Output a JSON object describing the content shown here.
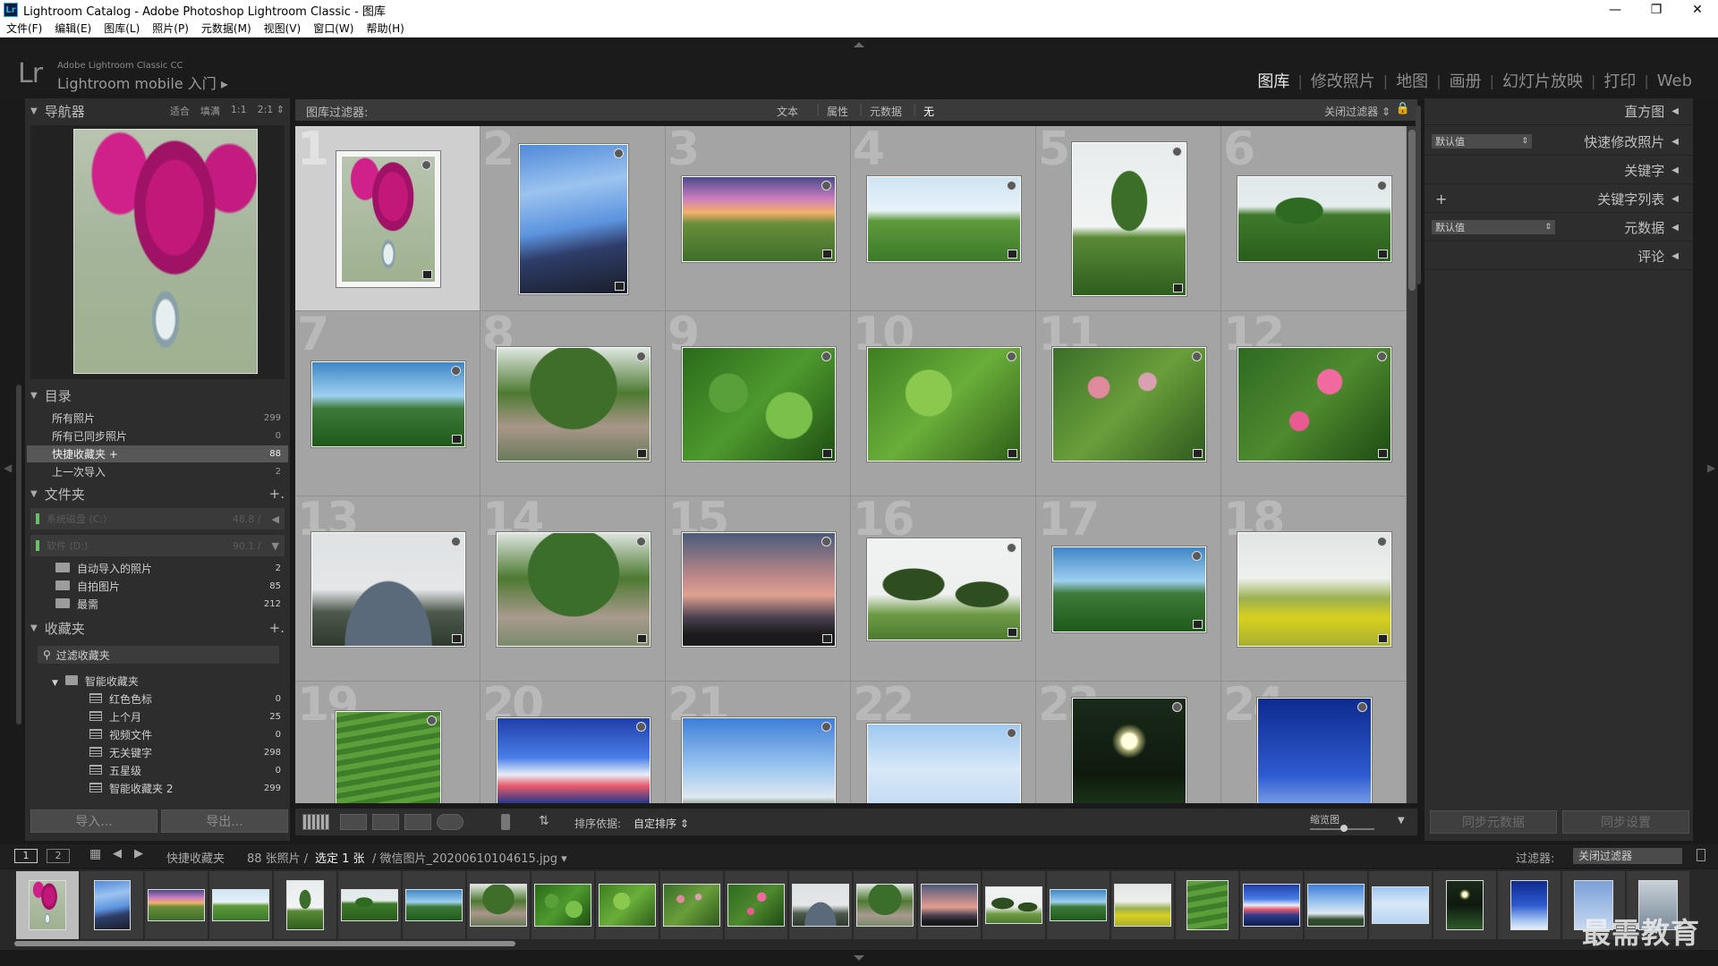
{
  "window": {
    "title": "Lightroom Catalog - Adobe Photoshop Lightroom Classic - 图库",
    "app_icon": "Lr",
    "controls": [
      "—",
      "❐",
      "✕"
    ]
  },
  "menu": [
    "文件(F)",
    "编辑(E)",
    "图库(L)",
    "照片(P)",
    "元数据(M)",
    "视图(V)",
    "窗口(W)",
    "帮助(H)"
  ],
  "identity": {
    "logo": "Lr",
    "small": "Adobe Lightroom Classic CC",
    "main": "Lightroom mobile 入门 ▸"
  },
  "modules": [
    "图库",
    "修改照片",
    "地图",
    "画册",
    "幻灯片放映",
    "打印",
    "Web"
  ],
  "navigator": {
    "title": "导航器",
    "zoom": [
      "适合",
      "填满",
      "1:1",
      "2:1 ⇕"
    ]
  },
  "catalog": {
    "title": "目录",
    "items": [
      {
        "label": "所有照片",
        "count": "299"
      },
      {
        "label": "所有已同步照片",
        "count": "0"
      },
      {
        "label": "快捷收藏夹 +",
        "count": "88"
      },
      {
        "label": "上一次导入",
        "count": "2"
      }
    ]
  },
  "folders": {
    "title": "文件夹",
    "add": "+.",
    "volumes": [
      {
        "label": "系统磁盘 (C:)",
        "size": "48.8 /",
        "arrow": "◀"
      },
      {
        "label": "软件 (D:)",
        "size": "90.1 /",
        "arrow": "▼"
      }
    ],
    "items": [
      {
        "label": "自动导入的照片",
        "count": "2"
      },
      {
        "label": "自拍图片",
        "count": "85"
      },
      {
        "label": "最需",
        "count": "212"
      }
    ]
  },
  "collections": {
    "title": "收藏夹",
    "add": "+.",
    "filter_label": "过滤收藏夹",
    "smart_group": "智能收藏夹",
    "items": [
      {
        "label": "红色色标",
        "count": "0"
      },
      {
        "label": "上个月",
        "count": "25"
      },
      {
        "label": "视频文件",
        "count": "0"
      },
      {
        "label": "无关键字",
        "count": "298"
      },
      {
        "label": "五星级",
        "count": "0"
      },
      {
        "label": "智能收藏夹 2",
        "count": "299"
      }
    ]
  },
  "left_buttons": {
    "import": "导入...",
    "export": "导出..."
  },
  "filter_bar": {
    "label": "图库过滤器:",
    "options": [
      "文本",
      "属性",
      "元数据",
      "无"
    ],
    "right": "关闭过滤器 ⇕"
  },
  "grid": {
    "numbers": [
      "1",
      "2",
      "3",
      "4",
      "5",
      "6",
      "7",
      "8",
      "9",
      "10",
      "11",
      "12",
      "13",
      "14",
      "15",
      "16",
      "17",
      "18",
      "19",
      "20",
      "21",
      "22",
      "23",
      "24"
    ]
  },
  "toolbar": {
    "sort_label": "排序依据:",
    "sort_value": "自定排序 ⇕",
    "thumb_label": "缩览图"
  },
  "right_panel": {
    "rows": [
      {
        "label": "直方图"
      },
      {
        "label": "快速修改照片",
        "select": "默认值"
      },
      {
        "label": "关键字"
      },
      {
        "label": "关键字列表",
        "plus": "+"
      },
      {
        "label": "元数据",
        "select": "默认值"
      },
      {
        "label": "评论"
      }
    ],
    "sync_metadata": "同步元数据",
    "sync_settings": "同步设置"
  },
  "filmstrip_bar": {
    "pages": [
      "1",
      "2"
    ],
    "source": "快捷收藏夹",
    "info": "88 张照片 /",
    "selected": "选定 1 张",
    "file": "/ 微信图片_20200610104615.jpg ▾",
    "filter_label": "过滤器:",
    "filter_value": "关闭过滤器"
  },
  "watermark": "最需教育"
}
